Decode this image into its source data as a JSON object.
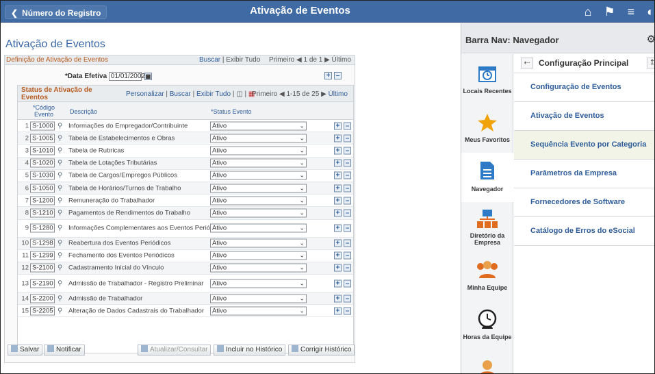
{
  "header": {
    "back_label": "Número do Registro",
    "title": "Ativação de Eventos",
    "icons": [
      "home-icon",
      "flag-icon",
      "menu-icon",
      "navbar-icon"
    ]
  },
  "page": {
    "title": "Ativação de Eventos",
    "section_title": "Definição de Ativação de Eventos",
    "links": {
      "find": "Buscar",
      "view_all": "Exibir Tudo"
    },
    "pager": {
      "first": "Primeiro",
      "range": "1 de 1",
      "last": "Último"
    },
    "effective_date_label": "*Data Efetiva",
    "effective_date_value": "01/01/2002"
  },
  "grid": {
    "title": "Status de Ativação de Eventos",
    "links": {
      "personalize": "Personalizar",
      "find": "Buscar",
      "view_all": "Exibir Tudo"
    },
    "pager": {
      "first": "Primeiro",
      "range": "1-15 de 25",
      "last": "Último"
    },
    "columns": {
      "code": "*Código Evento",
      "description": "Descrição",
      "status": "*Status Evento"
    },
    "rows": [
      {
        "n": "1",
        "code": "S-1000",
        "desc": "Informações do Empregador/Contribuinte",
        "status": "Ativo"
      },
      {
        "n": "2",
        "code": "S-1005",
        "desc": "Tabela de Estabelecimentos e Obras",
        "status": "Ativo"
      },
      {
        "n": "3",
        "code": "S-1010",
        "desc": "Tabela de Rubricas",
        "status": "Ativo"
      },
      {
        "n": "4",
        "code": "S-1020",
        "desc": "Tabela de Lotações Tributárias",
        "status": "Ativo"
      },
      {
        "n": "5",
        "code": "S-1030",
        "desc": "Tabela de Cargos/Empregos Públicos",
        "status": "Ativo"
      },
      {
        "n": "6",
        "code": "S-1050",
        "desc": "Tabela de Horários/Turnos de Trabalho",
        "status": "Ativo"
      },
      {
        "n": "7",
        "code": "S-1200",
        "desc": "Remuneração do Trabalhador",
        "status": "Ativo"
      },
      {
        "n": "8",
        "code": "S-1210",
        "desc": "Pagamentos de Rendimentos do Trabalho",
        "status": "Ativo"
      },
      {
        "n": "9",
        "code": "S-1280",
        "desc": "Informações Complementares aos Eventos Periódicos",
        "status": "Ativo"
      },
      {
        "n": "10",
        "code": "S-1298",
        "desc": "Reabertura dos Eventos Periódicos",
        "status": "Ativo"
      },
      {
        "n": "11",
        "code": "S-1299",
        "desc": "Fechamento dos Eventos Periódicos",
        "status": "Ativo"
      },
      {
        "n": "12",
        "code": "S-2100",
        "desc": "Cadastramento Inicial do Vínculo",
        "status": "Ativo"
      },
      {
        "n": "13",
        "code": "S-2190",
        "desc": "Admissão de Trabalhador - Registro Preliminar",
        "status": "Ativo"
      },
      {
        "n": "14",
        "code": "S-2200",
        "desc": "Admissão de Trabalhador",
        "status": "Ativo"
      },
      {
        "n": "15",
        "code": "S-2205",
        "desc": "Alteração de Dados Cadastrais do Trabalhador",
        "status": "Ativo"
      }
    ]
  },
  "actions": {
    "save": "Salvar",
    "notify": "Notificar",
    "update_display": "Atualizar/Consultar",
    "include_history": "Incluir no Histórico",
    "correct_history": "Corrigir Histórico"
  },
  "nav": {
    "title": "Barra Nav: Navegador",
    "tabs": [
      {
        "label": "Locais Recentes",
        "icon": "calendar-clock-icon"
      },
      {
        "label": "Meus Favoritos",
        "icon": "star-icon"
      },
      {
        "label": "Navegador",
        "icon": "document-icon"
      },
      {
        "label": "Diretório da Empresa",
        "icon": "org-chart-icon"
      },
      {
        "label": "Minha Equipe",
        "icon": "team-icon"
      },
      {
        "label": "Horas da Equipe",
        "icon": "clock-person-icon"
      }
    ],
    "list_title": "Configuração Principal",
    "items": [
      "Configuração de Eventos",
      "Ativação de Eventos",
      "Sequência Evento por Categoria",
      "Parâmetros da Empresa",
      "Fornecedores de Software",
      "Catálogo de Erros do eSocial"
    ]
  },
  "colors": {
    "header_bg": "#3f6aa3",
    "link": "#2e5c9a",
    "section_title": "#b85a1d",
    "nav_selected": "#f1f4e6"
  }
}
